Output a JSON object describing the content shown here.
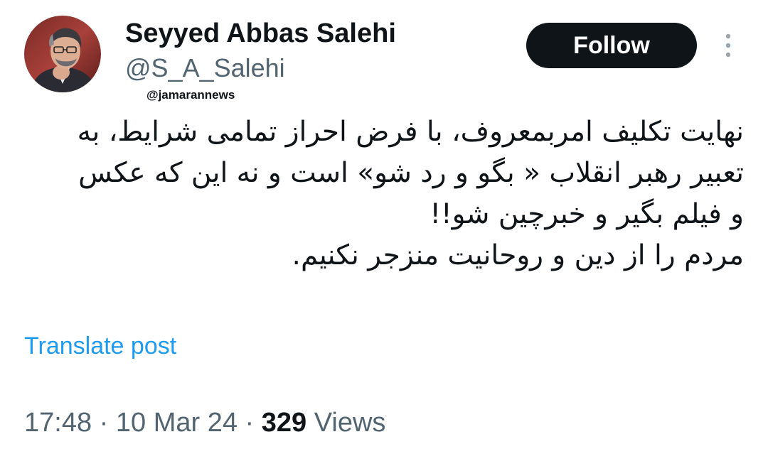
{
  "author": {
    "display_name": "Seyyed Abbas Salehi",
    "handle": "@S_A_Salehi"
  },
  "watermark": "@jamarannews",
  "follow_label": "Follow",
  "more_icon": "more-vertical-icon",
  "tweet": {
    "lines": [
      "نهایت تکلیف امربمعروف، با فرض احراز تمامی شرایط، به",
      "تعبیر رهبر انقلاب « بگو و رد شو» است و نه این که عکس",
      "و فیلم بگیر و خبرچین شو!!",
      "مردم را از دین و روحانیت منزجر نکنیم."
    ]
  },
  "translate_label": "Translate post",
  "meta": {
    "time": "17:48",
    "separator": "·",
    "date": "10 Mar 24",
    "views_count": "329",
    "views_label": "Views"
  },
  "colors": {
    "text_primary": "#0f1419",
    "text_secondary": "#536471",
    "link": "#1d9bf0",
    "follow_bg": "#0f1419"
  }
}
